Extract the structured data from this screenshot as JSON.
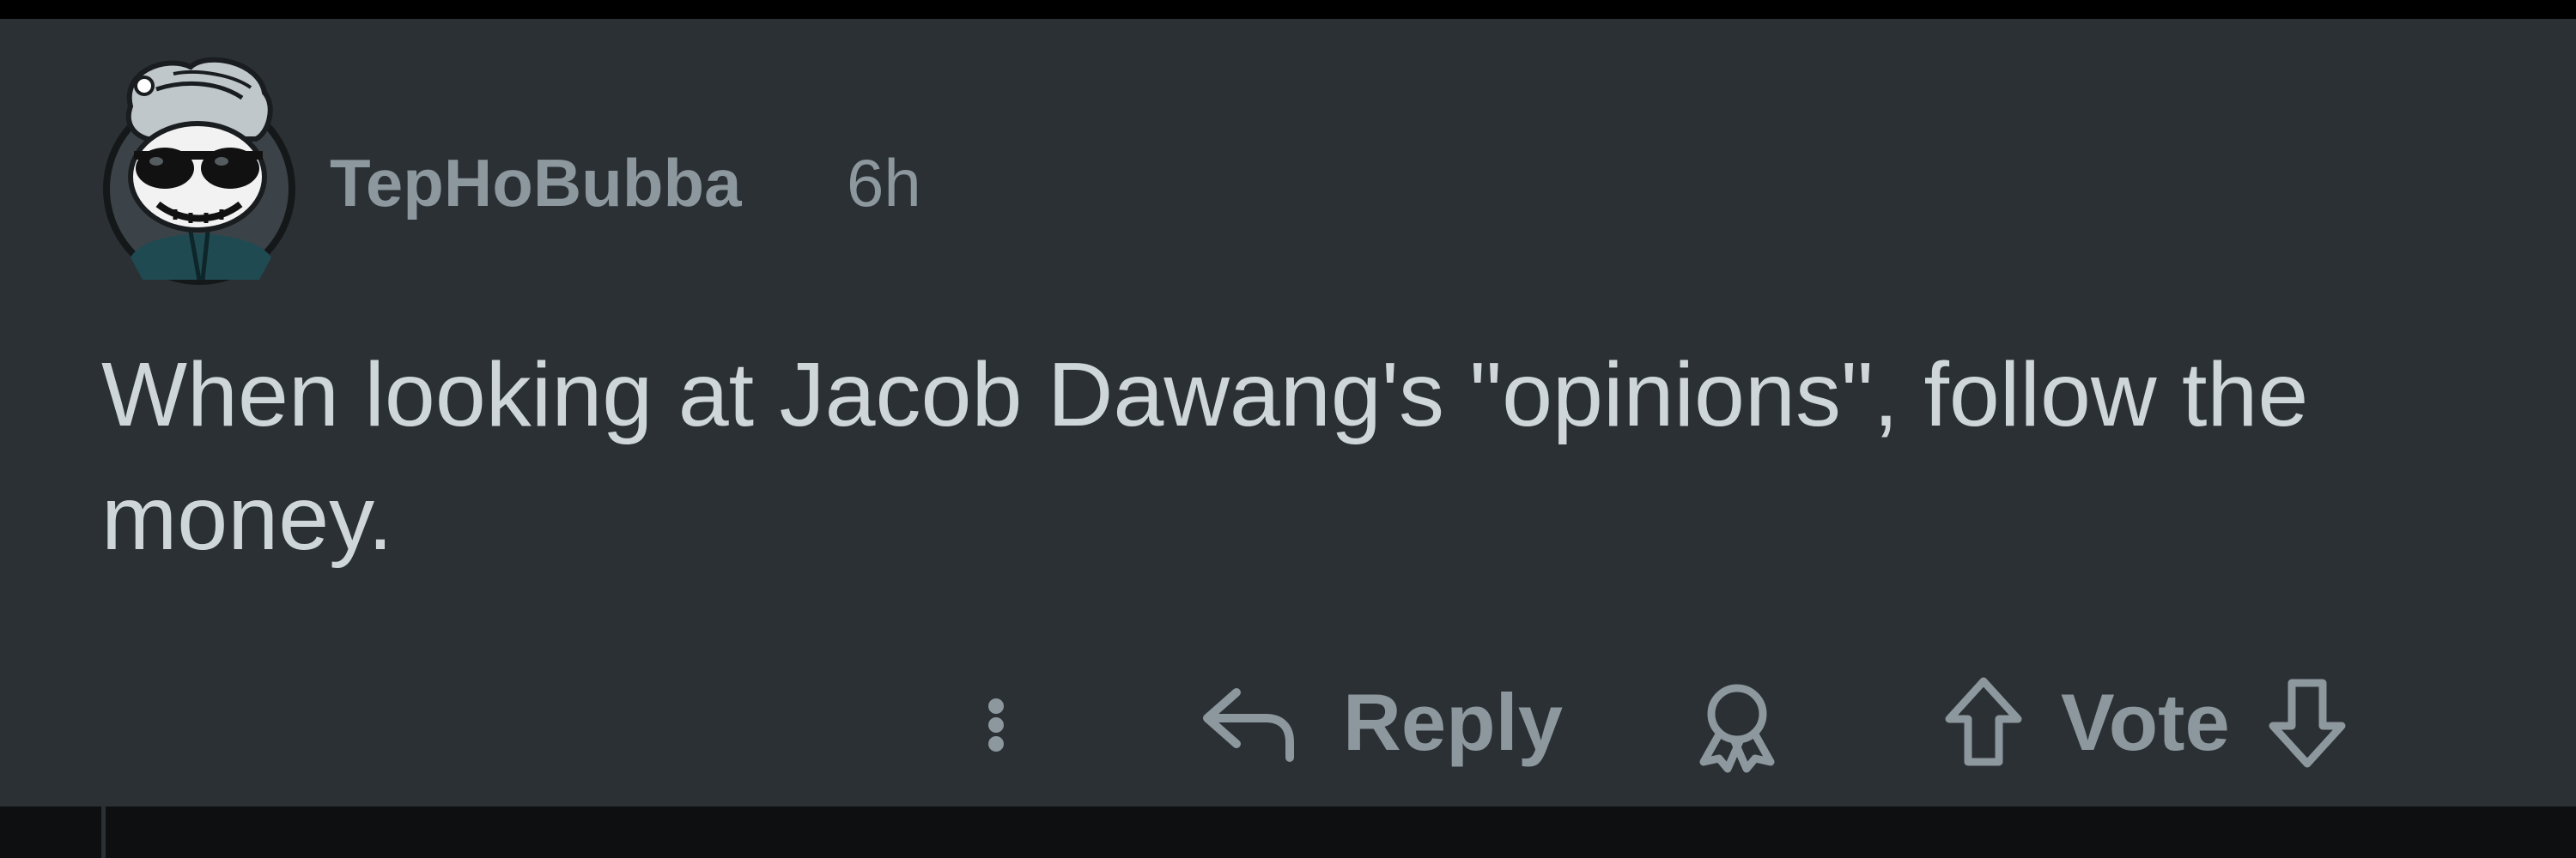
{
  "comment": {
    "username": "TepHoBubba",
    "timestamp": "6h",
    "body": "When looking at Jacob Dawang's \"opinions\", follow the money.",
    "avatar_icon": "avatar-sunglasses-icon"
  },
  "actions": {
    "more_icon": "more-vertical-icon",
    "reply_icon": "reply-arrow-icon",
    "reply_label": "Reply",
    "award_icon": "award-icon",
    "upvote_icon": "arrow-up-icon",
    "vote_label": "Vote",
    "downvote_icon": "arrow-down-icon"
  },
  "colors": {
    "background": "#2b3034",
    "body_text": "#cfd6da",
    "meta_text": "#8c979e"
  }
}
